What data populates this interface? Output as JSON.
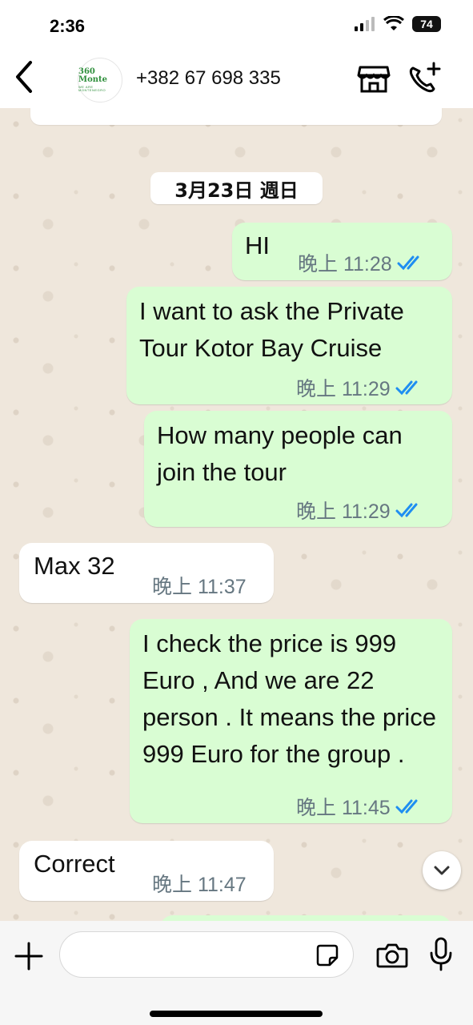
{
  "status_bar": {
    "time": "2:36",
    "battery": "74"
  },
  "header": {
    "contact_name": "+382 67 698 335",
    "avatar_logo": "360 Monte",
    "avatar_sub": "WE ARE MONTENEGRO"
  },
  "date_chip": "3月23日 週日",
  "messages": [
    {
      "direction": "out",
      "text": "HI",
      "time": "晚上 11:28",
      "status": "read"
    },
    {
      "direction": "out",
      "text": "I want to ask the Private Tour Kotor Bay Cruise",
      "time": "晚上 11:29",
      "status": "read"
    },
    {
      "direction": "out",
      "text": "How many people can join the tour",
      "time": "晚上 11:29",
      "status": "read"
    },
    {
      "direction": "in",
      "text": "Max 32",
      "time": "晚上 11:37"
    },
    {
      "direction": "out",
      "text": "I check the price is 999 Euro , And we are 22 person . It means the price 999 Euro for the group .",
      "time": "晚上 11:45",
      "status": "read"
    },
    {
      "direction": "in",
      "text": "Correct",
      "time": "晚上 11:47"
    }
  ],
  "composer": {
    "value": "",
    "placeholder": ""
  },
  "colors": {
    "outgoing_bubble": "#d9fdd3",
    "incoming_bubble": "#ffffff",
    "read_ticks": "#1f8ef1",
    "meta_text": "#667781"
  }
}
